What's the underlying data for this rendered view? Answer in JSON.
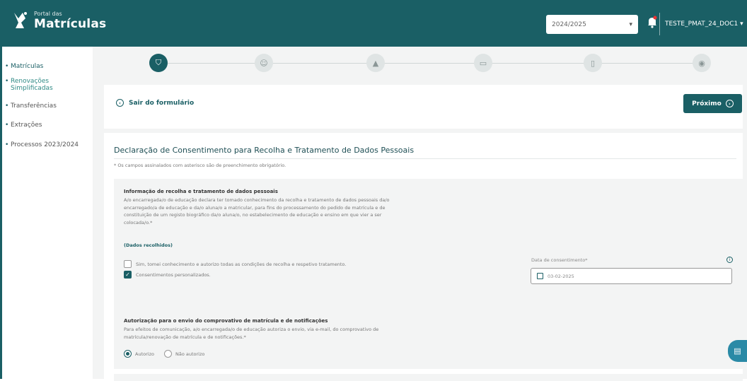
{
  "header": {
    "logo_small": "Portal das",
    "logo_big": "Matrículas",
    "year_value": "2024/2025",
    "user_name": "TESTE_PMAT_24_DOC1"
  },
  "sidebar": {
    "items": [
      {
        "label": "Matrículas"
      },
      {
        "label": "Renovações Simplificadas"
      },
      {
        "label": "Transferências"
      },
      {
        "label": "Extrações"
      },
      {
        "label": "Processos 2023/2024"
      }
    ]
  },
  "stepper": {
    "steps": [
      {
        "icon": "shield-icon"
      },
      {
        "icon": "person-icon"
      },
      {
        "icon": "graduation-cap-icon"
      },
      {
        "icon": "id-card-icon"
      },
      {
        "icon": "document-icon"
      },
      {
        "icon": "eye-icon"
      }
    ]
  },
  "actions": {
    "exit_label": "Sair do formulário",
    "next_label": "Próximo"
  },
  "form": {
    "title": "Declaração de Consentimento para Recolha e Tratamento de Dados Pessoais",
    "required_note": "* Os campos assinalados com asterisco são de preenchimento obrigatório.",
    "section1": {
      "heading": "Informação de recolha e tratamento de dados pessoais",
      "text": "A/o encarregada/o de educação declara ter tomado conhecimento da recolha e tratamento de dados pessoais da/o encarregado/a de educação e da/o aluna/o a matricular, para fins do processamento do pedido de matrícula e de constituição de um registo biográfico da/o aluna/o, no estabelecimento de educação e ensino em que vier a ser colocada/o.*",
      "sub_heading": "(Dados recolhidos)",
      "checkbox1_label": "Sim, tomei conhecimento e autorizo todas as condições de recolha e respetivo tratamento.",
      "checkbox2_label": "Consentimentos personalizados.",
      "date_label": "Data de consentimento*",
      "date_value": "03-02-2025"
    },
    "section2": {
      "heading": "Autorização para o envio do comprovativo de matrícula e de notificações",
      "text": "Para efeitos de comunicação, a/o encarregada/o de educação autoriza o envio, via e-mail, do comprovativo de matrícula/renovação de matrícula e de notificações.*",
      "radio1_label": "Autorizo",
      "radio2_label": "Não autorizo"
    }
  },
  "colors": {
    "primary": "#1a5f65",
    "chat": "#2a8aa6"
  }
}
